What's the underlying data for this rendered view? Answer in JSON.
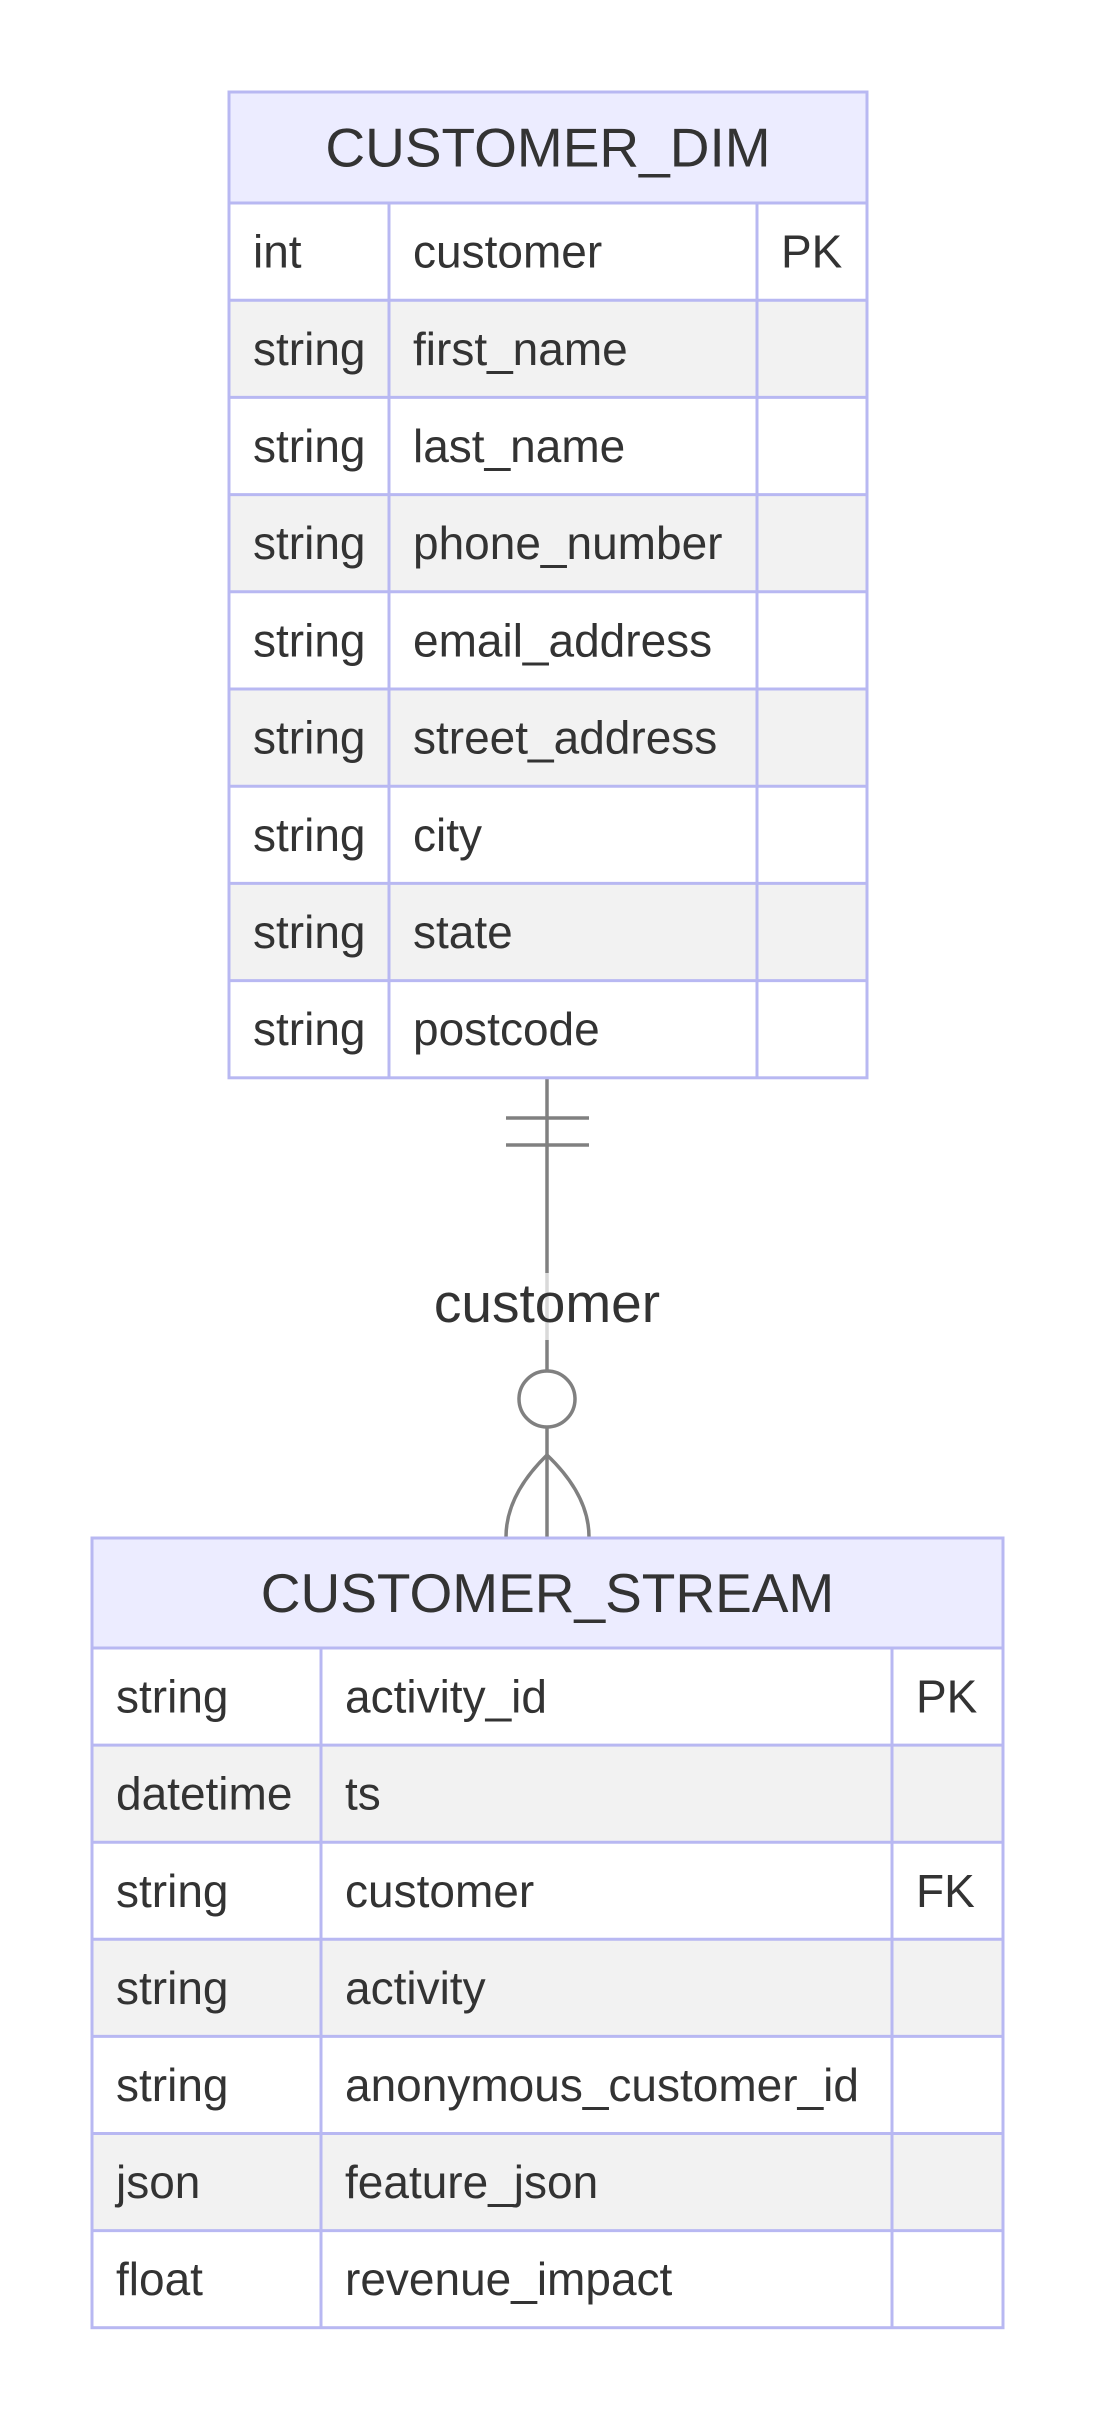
{
  "diagram": {
    "type": "entity-relationship",
    "colors": {
      "header_fill": "#ececff",
      "border": "#b8b8f2",
      "row_alt_fill": "#f2f2f2",
      "row_fill": "#ffffff",
      "text": "#333333",
      "relationship_line": "#808080"
    },
    "entities": [
      {
        "id": "customer_dim",
        "name": "CUSTOMER_DIM",
        "attributes": [
          {
            "type": "int",
            "name": "customer",
            "key": "PK"
          },
          {
            "type": "string",
            "name": "first_name",
            "key": ""
          },
          {
            "type": "string",
            "name": "last_name",
            "key": ""
          },
          {
            "type": "string",
            "name": "phone_number",
            "key": ""
          },
          {
            "type": "string",
            "name": "email_address",
            "key": ""
          },
          {
            "type": "string",
            "name": "street_address",
            "key": ""
          },
          {
            "type": "string",
            "name": "city",
            "key": ""
          },
          {
            "type": "string",
            "name": "state",
            "key": ""
          },
          {
            "type": "string",
            "name": "postcode",
            "key": ""
          }
        ]
      },
      {
        "id": "customer_stream",
        "name": "CUSTOMER_STREAM",
        "attributes": [
          {
            "type": "string",
            "name": "activity_id",
            "key": "PK"
          },
          {
            "type": "datetime",
            "name": "ts",
            "key": ""
          },
          {
            "type": "string",
            "name": "customer",
            "key": "FK"
          },
          {
            "type": "string",
            "name": "activity",
            "key": ""
          },
          {
            "type": "string",
            "name": "anonymous_customer_id",
            "key": ""
          },
          {
            "type": "json",
            "name": "feature_json",
            "key": ""
          },
          {
            "type": "float",
            "name": "revenue_impact",
            "key": ""
          }
        ]
      }
    ],
    "relationships": [
      {
        "from": "CUSTOMER_DIM",
        "to": "CUSTOMER_STREAM",
        "label": "customer",
        "from_cardinality": "exactly-one",
        "to_cardinality": "zero-or-more"
      }
    ]
  }
}
